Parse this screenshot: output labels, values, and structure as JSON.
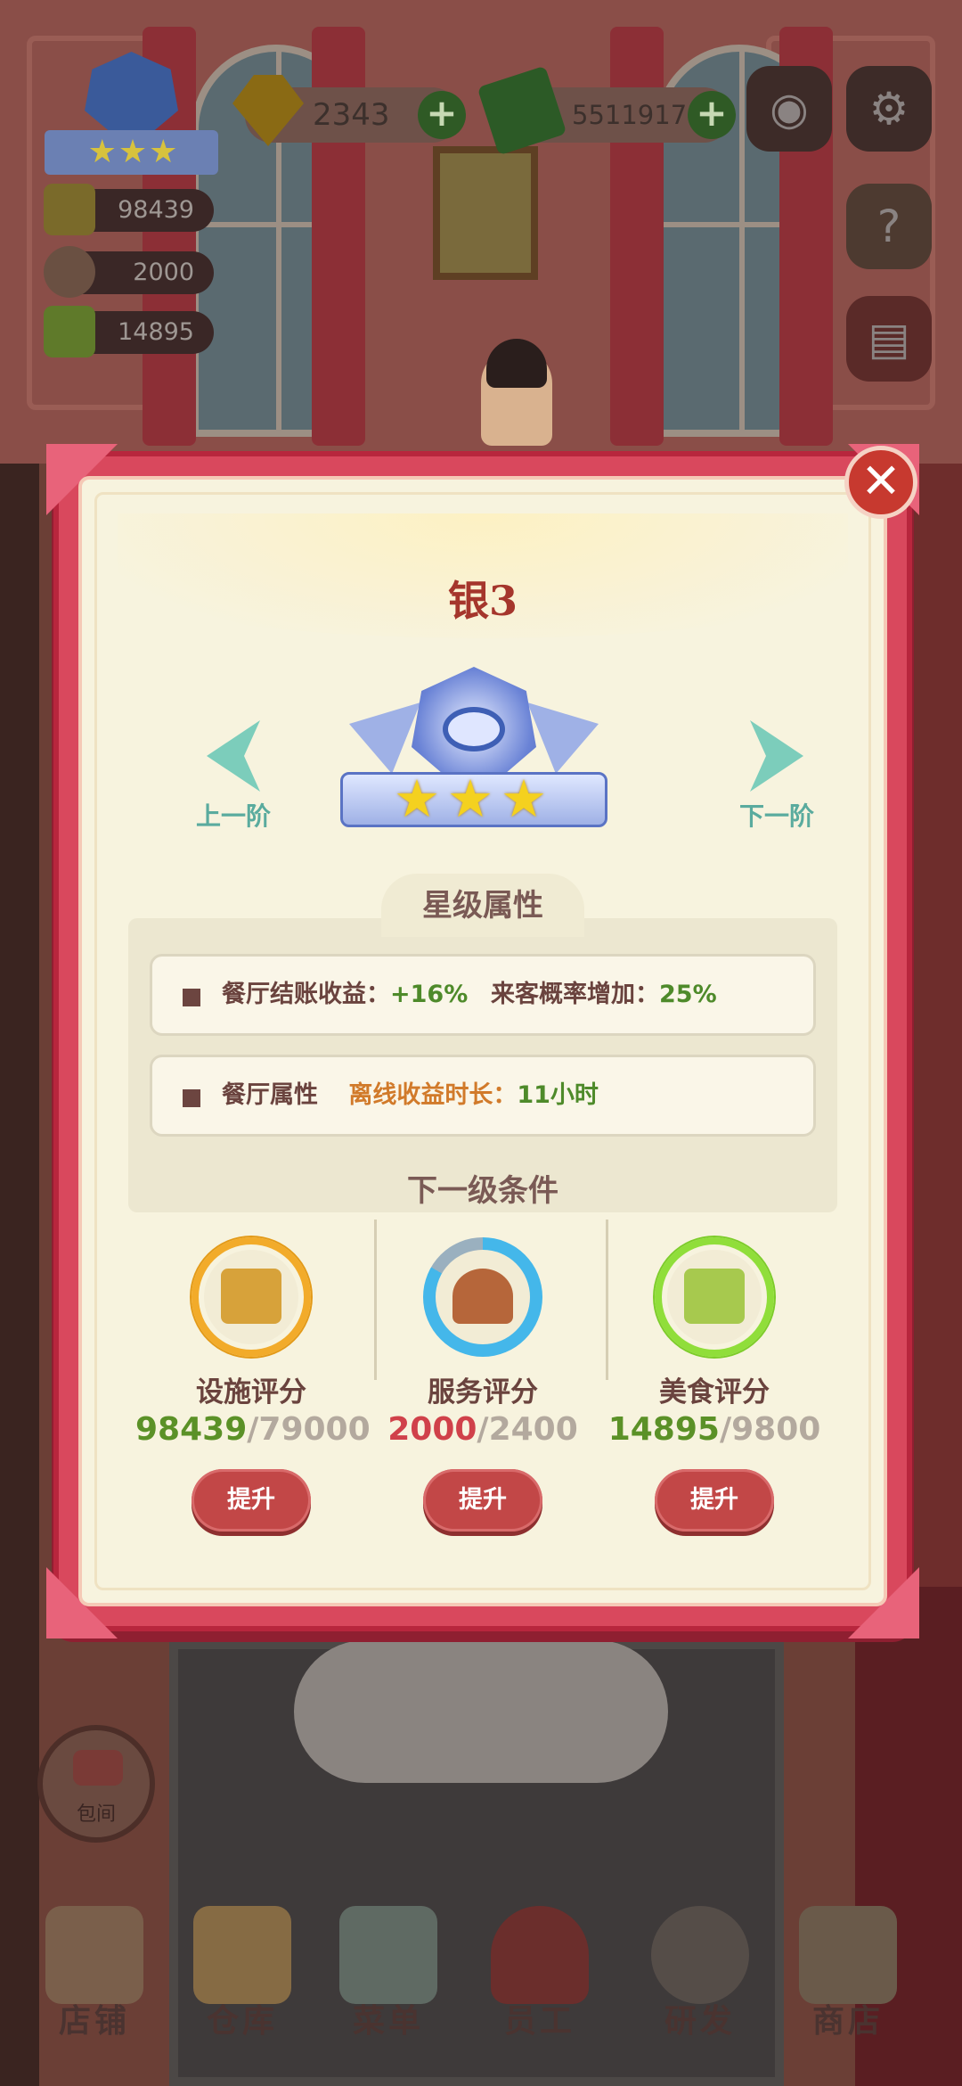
{
  "hud": {
    "facility_score": "98439",
    "service_score": "2000",
    "food_score": "14895",
    "gems": "2343",
    "cash": "5511917",
    "plus_symbol": "+",
    "rank_badge_stars": "★★★"
  },
  "icons": {
    "camera": "camera-icon",
    "settings": "gear-icon",
    "guide": "book-question-icon",
    "recipe": "recipe-book-icon",
    "close": "close-icon"
  },
  "modal": {
    "title": "银3",
    "prev_label": "上一阶",
    "next_label": "下一阶",
    "badge_stars": "★★★",
    "star_count": 3,
    "attributes_title": "星级属性",
    "attr_row1": {
      "label": "餐厅结账收益：",
      "value": "+16%",
      "label2": "来客概率增加：",
      "value2": "25%"
    },
    "attr_row2": {
      "label": "餐厅属性",
      "value_label": "离线收益时长：",
      "value": "11小时"
    },
    "conditions_title": "下一级条件",
    "conditions": [
      {
        "name": "设施评分",
        "current": "98439",
        "required": "/79000",
        "button": "提升"
      },
      {
        "name": "服务评分",
        "current": "2000",
        "required": "/2400",
        "button": "提升"
      },
      {
        "name": "美食评分",
        "current": "14895",
        "required": "/9800",
        "button": "提升"
      }
    ],
    "close_symbol": "✕"
  },
  "private_room_label": "包间",
  "bottom_nav": [
    "店铺",
    "仓库",
    "菜单",
    "员工",
    "研发",
    "商店"
  ],
  "colors": {
    "modal_frame": "#d9485d",
    "modal_bg": "#f7f3de",
    "title": "#a5362c",
    "met_value": "#5b9127",
    "unmet_value": "#d0414a",
    "button": "#c24747",
    "nav_arrow": "#7ccdbb"
  }
}
